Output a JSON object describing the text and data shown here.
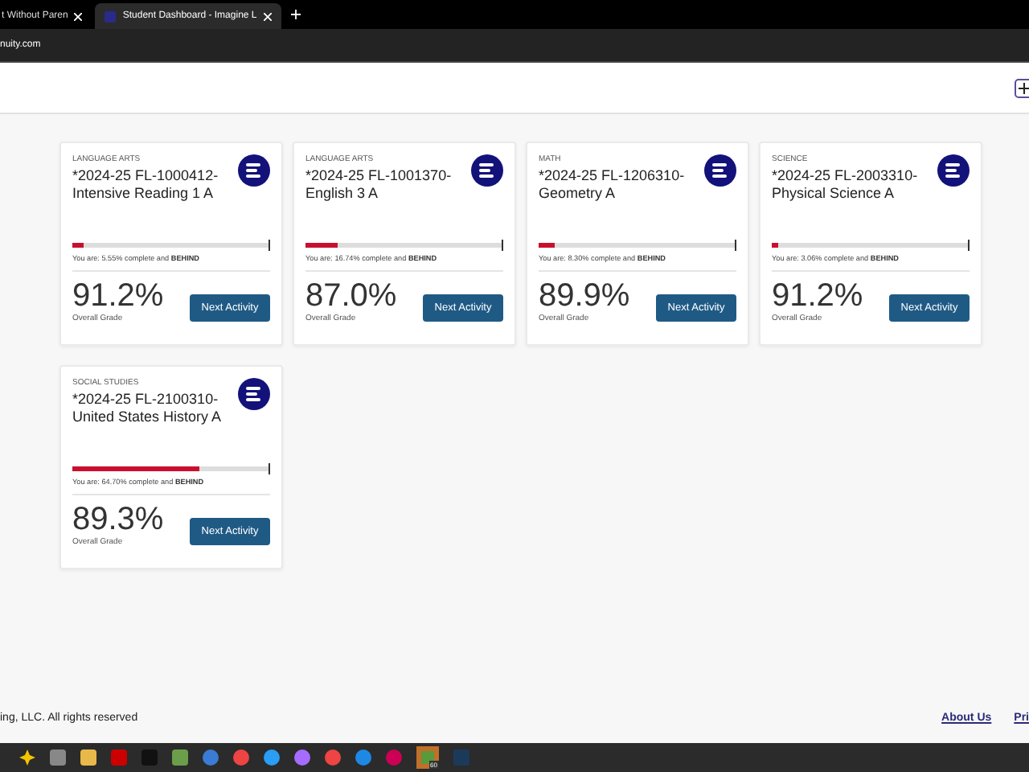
{
  "browser": {
    "tabs": [
      {
        "title": "t Without Paren",
        "selected": false
      },
      {
        "title": "Student Dashboard - Imagine L",
        "selected": true
      }
    ],
    "address": "nuity.com"
  },
  "courses": [
    {
      "category": "LANGUAGE ARTS",
      "title": "*2024-25 FL-1000412-Intensive Reading 1 A",
      "level": 0.0555,
      "status": "You are: 5.55% complete and **BEHIND**",
      "grade": "91.2%",
      "grade_label": "Overall Grade",
      "button": "Next Activity"
    },
    {
      "category": "LANGUAGE ARTS",
      "title": "*2024-25 FL-1001370-English 3 A",
      "level": 0.1674,
      "status": "You are: 16.74% complete and **BEHIND**",
      "grade": "87.0%",
      "grade_label": "Overall Grade",
      "button": "Next Activity"
    },
    {
      "category": "MATH",
      "title": "*2024-25 FL-1206310-Geometry A",
      "level": 0.083,
      "status": "You are: 8.30% complete and **BEHIND**",
      "grade": "89.9%",
      "grade_label": "Overall Grade",
      "button": "Next Activity"
    },
    {
      "category": "SCIENCE",
      "title": "*2024-25 FL-2003310-Physical Science A",
      "level": 0.0306,
      "status": "You are: 3.06% complete and **BEHIND**",
      "grade": "91.2%",
      "grade_label": "Overall Grade",
      "button": "Next Activity"
    },
    {
      "category": "SOCIAL STUDIES",
      "title": "*2024-25 FL-2100310-United States History A",
      "level": 0.647,
      "status": "You are: 64.70% complete and **BEHIND**",
      "grade": "89.3%",
      "grade_label": "Overall Grade",
      "button": "Next Activity"
    }
  ],
  "footer": {
    "copyright": "ing, LLC. All rights reserved",
    "links": [
      "About Us",
      "Pri"
    ]
  },
  "taskbar": {
    "badge": "60"
  }
}
